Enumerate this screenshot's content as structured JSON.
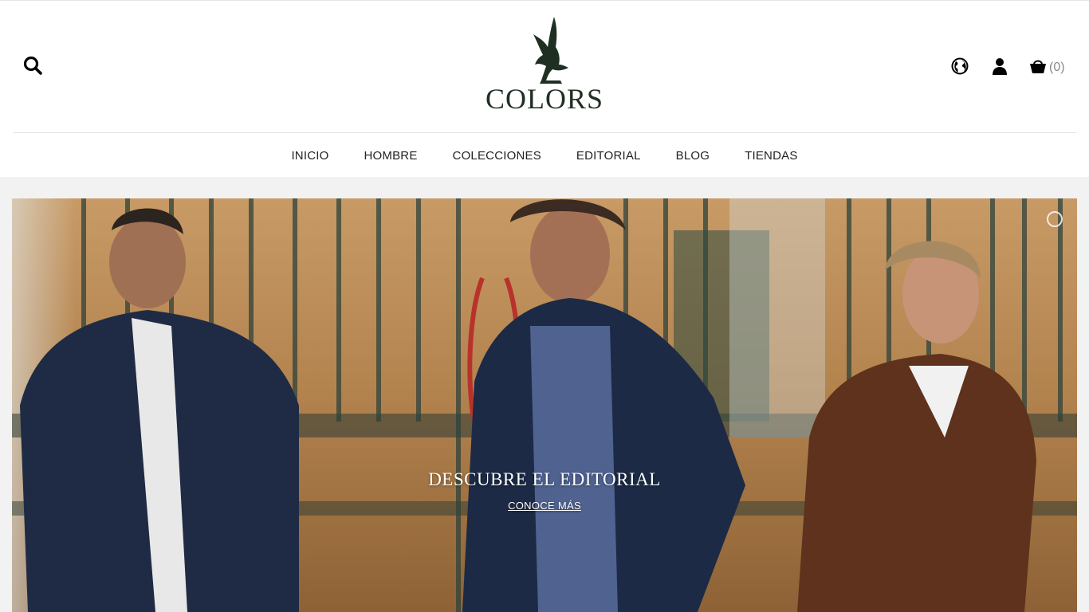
{
  "header": {
    "brand": "COLORS",
    "cart_count": "(0)",
    "icons": {
      "search": "search-icon",
      "globe": "globe-icon",
      "account": "user-icon",
      "cart": "basket-icon"
    }
  },
  "nav": {
    "items": [
      {
        "label": "INICIO"
      },
      {
        "label": "HOMBRE"
      },
      {
        "label": "COLECCIONES"
      },
      {
        "label": "EDITORIAL"
      },
      {
        "label": "BLOG"
      },
      {
        "label": "TIENDAS"
      }
    ]
  },
  "hero": {
    "title": "DESCUBRE EL EDITORIAL",
    "link": "CONOCE MÁS"
  },
  "colors": {
    "brand_green": "#1f3022",
    "background": "#f2f2f2"
  }
}
